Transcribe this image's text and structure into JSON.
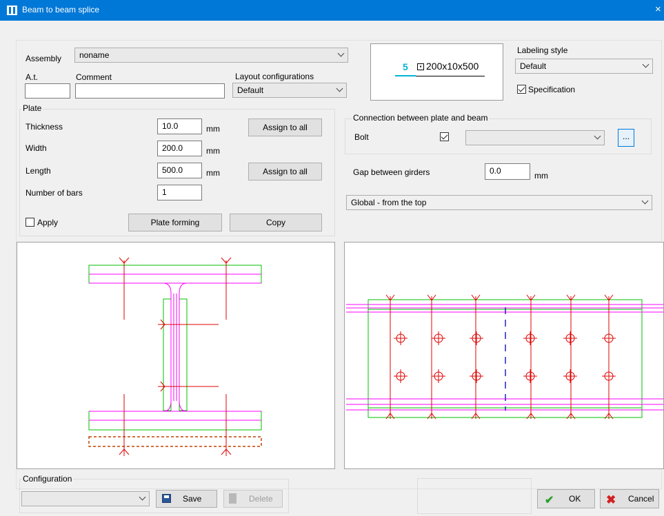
{
  "window": {
    "title": "Beam to beam splice",
    "close": "×"
  },
  "assembly": {
    "label": "Assembly",
    "value": "noname"
  },
  "at": {
    "label": "A.t.",
    "value": ""
  },
  "comment": {
    "label": "Comment",
    "value": ""
  },
  "layout_configurations": {
    "label": "Layout configurations",
    "value": "Default"
  },
  "preview_label": {
    "number": "5",
    "profile": "200x10x500",
    "color": "#00b4d8"
  },
  "labeling_style": {
    "label": "Labeling style",
    "value": "Default"
  },
  "specification": {
    "label": "Specification",
    "checked": true
  },
  "plate": {
    "title": "Plate",
    "thickness": {
      "label": "Thickness",
      "value": "10.0",
      "unit": "mm"
    },
    "width": {
      "label": "Width",
      "value": "200.0",
      "unit": "mm"
    },
    "length": {
      "label": "Length",
      "value": "500.0",
      "unit": "mm"
    },
    "bars": {
      "label": "Number of bars",
      "value": "1"
    },
    "assign_all": "Assign to all",
    "apply": {
      "label": "Apply",
      "checked": false
    },
    "plate_forming": "Plate forming",
    "copy": "Copy"
  },
  "connection": {
    "title": "Connection between plate and beam",
    "bolt": {
      "label": "Bolt",
      "checked": true,
      "value": ""
    },
    "more": "..."
  },
  "gap": {
    "label": "Gap between girders",
    "value": "0.0",
    "unit": "mm"
  },
  "view": {
    "value": "Global - from the top"
  },
  "configuration": {
    "title": "Configuration",
    "value": "",
    "save": "Save",
    "delete": "Delete"
  },
  "ok": "OK",
  "cancel": "Cancel",
  "colors": {
    "accent": "#0078d7",
    "steel": "#ff00ff",
    "plate": "#00c000",
    "axis": "#e00000",
    "bolt_axis": "#2020c0",
    "slot": "#c04000"
  }
}
